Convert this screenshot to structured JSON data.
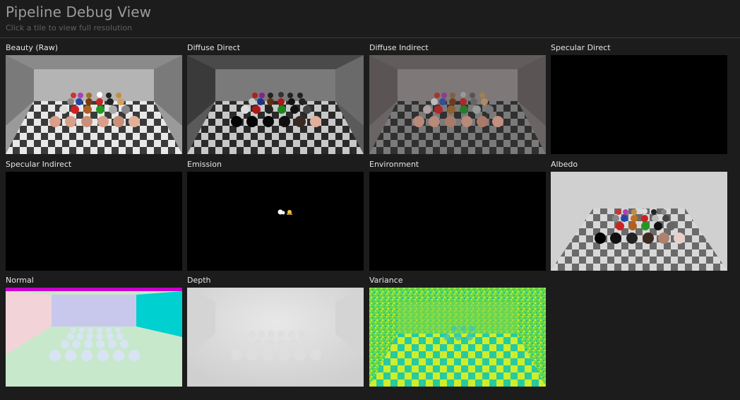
{
  "header": {
    "title": "Pipeline Debug View",
    "subtitle": "Click a tile to view full resolution"
  },
  "tiles": [
    {
      "label": "Beauty (Raw)",
      "icon": "beauty-render"
    },
    {
      "label": "Diffuse Direct",
      "icon": "diffuse-direct-render"
    },
    {
      "label": "Diffuse Indirect",
      "icon": "diffuse-indirect-render"
    },
    {
      "label": "Specular Direct",
      "icon": "specular-direct-render"
    },
    {
      "label": "Specular Indirect",
      "icon": "specular-indirect-render"
    },
    {
      "label": "Emission",
      "icon": "emission-render"
    },
    {
      "label": "Environment",
      "icon": "environment-render"
    },
    {
      "label": "Albedo",
      "icon": "albedo-render"
    },
    {
      "label": "Normal",
      "icon": "normal-render"
    },
    {
      "label": "Depth",
      "icon": "depth-render"
    },
    {
      "label": "Variance",
      "icon": "variance-render"
    }
  ],
  "colors": {
    "background": "#1c1c1c",
    "title": "#9b9b9b",
    "subtitle": "#5f5f5f",
    "label": "#e6e6e6",
    "divider": "#3a3a3a"
  }
}
